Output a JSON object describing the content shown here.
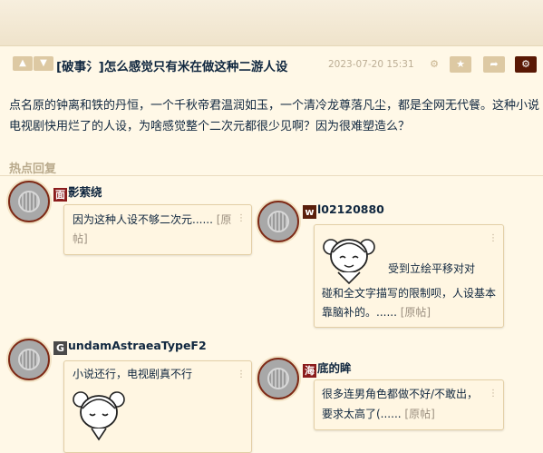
{
  "topic": {
    "title": "[破事氵]怎么感觉只有米在做这种二游人设",
    "date": "2023-07-20 15:31",
    "content": "点名原的钟离和铁的丹恒，一个千秋帝君温润如玉，一个清冷龙尊落凡尘，都是全网无代餐。这种小说电视剧快用烂了的人设，为啥感觉整个二次元都很少见啊？因为很难塑造么？"
  },
  "hot_label": "热点回复",
  "original_link": "[原帖]",
  "replies": [
    {
      "badge": "面",
      "badge_color": "#8b1c1c",
      "name_rest": "影萦绕",
      "text": "因为这种人设不够二次元......"
    },
    {
      "badge": "w",
      "badge_color": "#5a1f0c",
      "name_rest": "l02120880",
      "text_line1": "受到立绘平移对对",
      "text_line2": "碰和全文字描写的限制呗，人设基本",
      "text_line3": "靠脑补的。......"
    },
    {
      "badge": "G",
      "badge_color": "#4a4a4a",
      "name_rest": "undamAstraeaTypeF2",
      "text": "小说还行，电视剧真不行"
    },
    {
      "badge": "海",
      "badge_color": "#8b1c1c",
      "name_rest": "底的眸",
      "text_line1": "很多连男角色都做不好/不敢出，",
      "text_line2": "要求太高了(......"
    }
  ],
  "icons": [
    "thumb-up-icon",
    "thumb-down-icon",
    "android-icon",
    "star-icon",
    "share-icon",
    "gear-icon",
    "more-icon"
  ]
}
